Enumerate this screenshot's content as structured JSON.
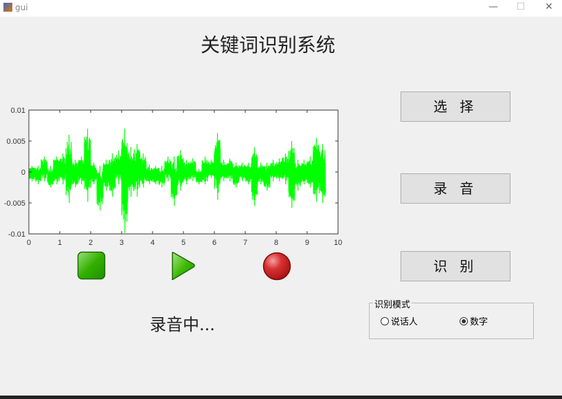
{
  "window": {
    "title": "gui",
    "minimize": "—",
    "maximize": "☐",
    "close": "✕"
  },
  "app": {
    "heading": "关键词识别系统",
    "status": "录音中..."
  },
  "buttons": {
    "select": "选 择",
    "record": "录 音",
    "recognize": "识 别"
  },
  "controls": {
    "stop_icon": "stop-icon",
    "play_icon": "play-icon",
    "record_icon": "record-icon",
    "stop_color": "#22a000",
    "play_color": "#33b000",
    "record_color": "#cc2020"
  },
  "mode_group": {
    "legend": "识别模式",
    "options": [
      {
        "label": "说话人",
        "selected": false
      },
      {
        "label": "数字",
        "selected": true
      }
    ]
  },
  "chart_data": {
    "type": "line",
    "color": "#00ff00",
    "xlim": [
      0,
      10
    ],
    "ylim": [
      -0.01,
      0.01
    ],
    "x_ticks": [
      "0",
      "1",
      "2",
      "3",
      "4",
      "5",
      "6",
      "7",
      "8",
      "9",
      "10"
    ],
    "y_ticks": [
      "0.01",
      "0.005",
      "0",
      "-0.005",
      "-0.01"
    ],
    "envelope_bin_width": 0.2,
    "envelope": [
      [
        -0.0015,
        0.001
      ],
      [
        -0.002,
        0.001
      ],
      [
        -0.0015,
        0.0025
      ],
      [
        -0.0025,
        0.001
      ],
      [
        -0.002,
        0.0025
      ],
      [
        -0.002,
        0.003
      ],
      [
        -0.005,
        0.006
      ],
      [
        -0.0025,
        0.002
      ],
      [
        -0.002,
        0.0025
      ],
      [
        -0.0048,
        0.007
      ],
      [
        -0.002,
        0.0015
      ],
      [
        -0.0062,
        0.001
      ],
      [
        -0.003,
        0.002
      ],
      [
        -0.004,
        0.003
      ],
      [
        -0.002,
        0.0035
      ],
      [
        -0.0098,
        0.007
      ],
      [
        -0.004,
        0.004
      ],
      [
        -0.004,
        0.0045
      ],
      [
        -0.0025,
        0.003
      ],
      [
        -0.002,
        0.0012
      ],
      [
        -0.002,
        0.001
      ],
      [
        -0.0025,
        0.001
      ],
      [
        -0.0015,
        0.0025
      ],
      [
        -0.0055,
        0.0025
      ],
      [
        -0.003,
        0.0035
      ],
      [
        -0.002,
        0.002
      ],
      [
        -0.0015,
        0.0022
      ],
      [
        -0.002,
        0.0005
      ],
      [
        -0.002,
        0.0025
      ],
      [
        -0.001,
        0.002
      ],
      [
        -0.0045,
        0.0063
      ],
      [
        -0.0015,
        0.002
      ],
      [
        -0.0015,
        0.0022
      ],
      [
        -0.0025,
        0.0015
      ],
      [
        -0.0015,
        0.0015
      ],
      [
        -0.002,
        0.0015
      ],
      [
        -0.0055,
        0.004
      ],
      [
        -0.002,
        0.0015
      ],
      [
        -0.003,
        0.0015
      ],
      [
        -0.0015,
        0.002
      ],
      [
        -0.0015,
        0.0022
      ],
      [
        -0.002,
        0.003
      ],
      [
        -0.0058,
        0.005
      ],
      [
        -0.003,
        0.002
      ],
      [
        -0.002,
        0.002
      ],
      [
        -0.0025,
        0.0025
      ],
      [
        -0.0048,
        0.0055
      ],
      [
        -0.005,
        0.0045
      ]
    ]
  }
}
